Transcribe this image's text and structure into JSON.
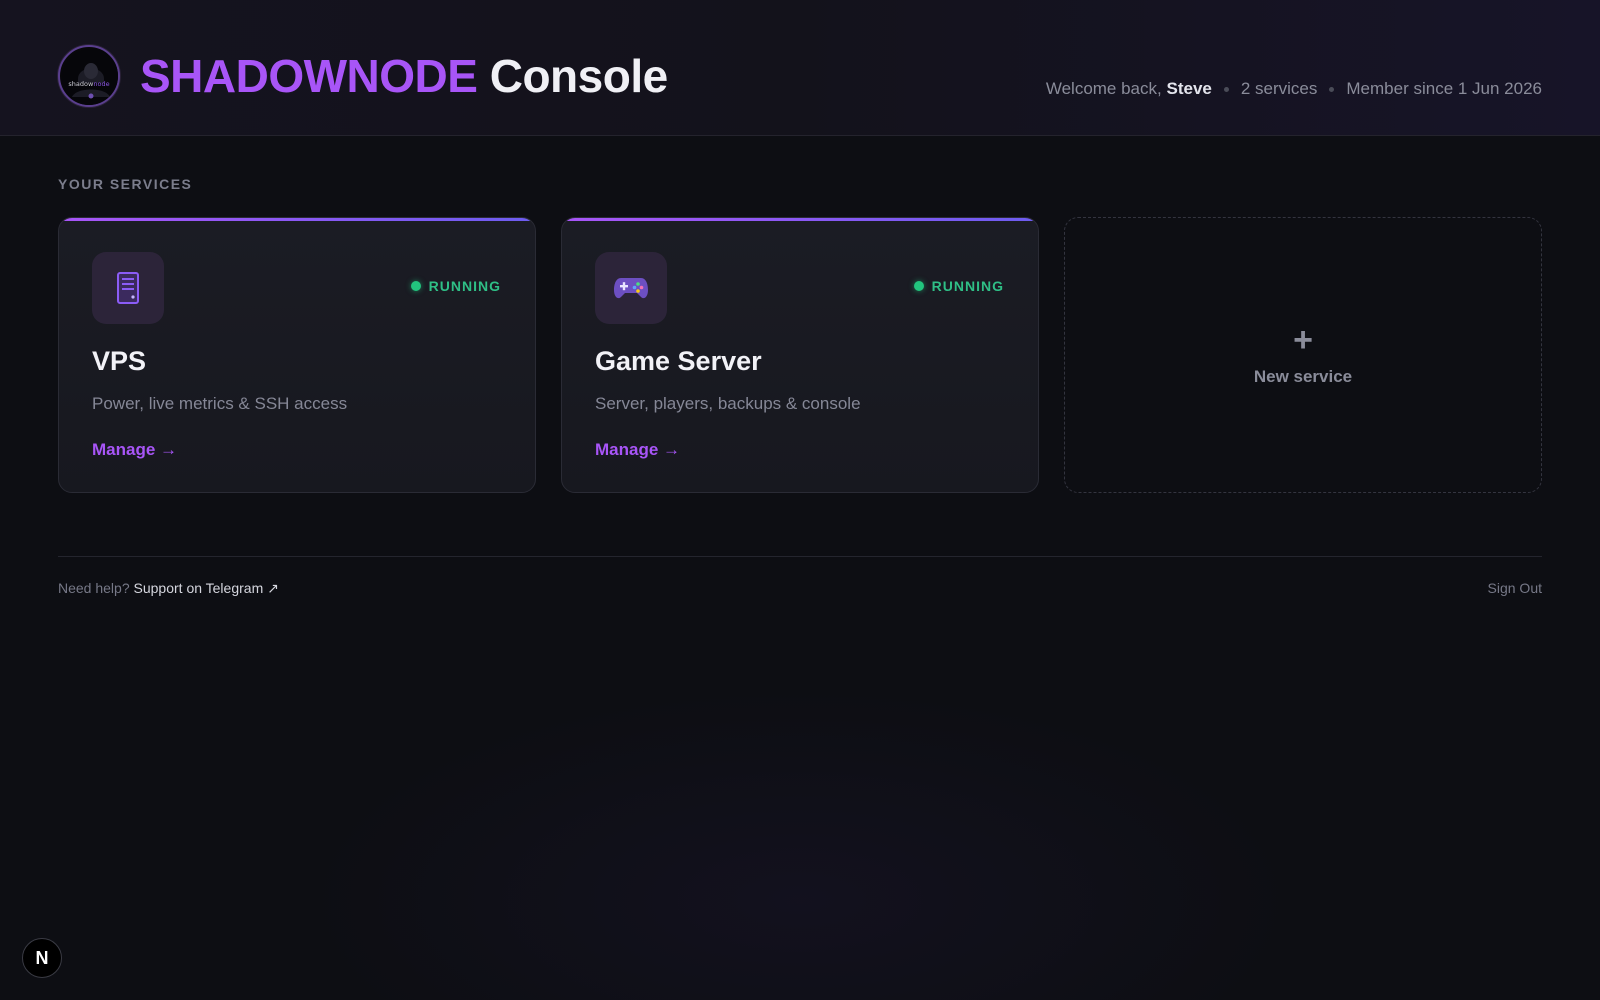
{
  "header": {
    "brand_accent": "SHADOWNODE",
    "brand_rest": "Console",
    "logo_text_a": "shadow",
    "logo_text_b": "node",
    "welcome_prefix": "Welcome back,",
    "user_name": "Steve",
    "services_count": "2 services",
    "member_since": "Member since 1 Jun 2026"
  },
  "main": {
    "section_title": "YOUR SERVICES",
    "services": [
      {
        "icon": "server-icon",
        "status": "RUNNING",
        "title": "VPS",
        "description": "Power, live metrics & SSH access",
        "action": "Manage →"
      },
      {
        "icon": "gamepad-icon",
        "status": "RUNNING",
        "title": "Game Server",
        "description": "Server, players, backups & console",
        "action": "Manage →"
      }
    ],
    "new_service": {
      "icon": "plus-icon",
      "label": "New service"
    }
  },
  "footer": {
    "help_prefix": "Need help?",
    "support_link": "Support on Telegram ↗",
    "sign_out": "Sign Out"
  },
  "dev_badge": {
    "icon": "n-logo-icon",
    "label": "N"
  },
  "colors": {
    "accent": "#a855f7",
    "running": "#22c57e",
    "background": "#0d0e13"
  }
}
